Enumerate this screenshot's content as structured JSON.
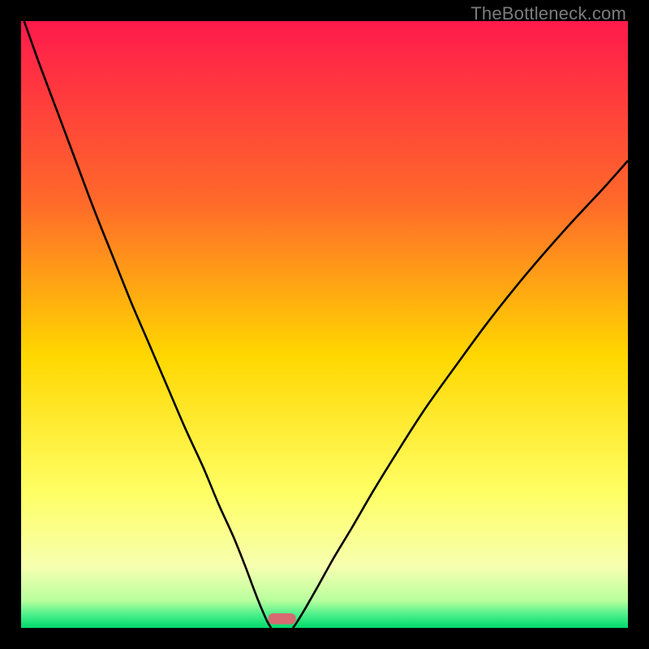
{
  "watermark": "TheBottleneck.com",
  "chart_data": {
    "type": "line",
    "title": "",
    "xlabel": "",
    "ylabel": "",
    "xlim": [
      0,
      1
    ],
    "ylim": [
      0,
      1
    ],
    "gradient_stops": [
      {
        "y": 0.0,
        "color": "#ff1a4b"
      },
      {
        "y": 0.3,
        "color": "#ff6a2a"
      },
      {
        "y": 0.55,
        "color": "#ffd700"
      },
      {
        "y": 0.78,
        "color": "#ffff66"
      },
      {
        "y": 0.9,
        "color": "#f6ffb0"
      },
      {
        "y": 0.955,
        "color": "#b8ff9e"
      },
      {
        "y": 0.978,
        "color": "#4cf08a"
      },
      {
        "y": 1.0,
        "color": "#00d96b"
      }
    ],
    "left_curve": {
      "note": "v-shaped curve left branch, (x, y) with y=1 at top, y≈0 near x≈0.40",
      "points": [
        [
          0.005,
          1.0
        ],
        [
          0.03,
          0.93
        ],
        [
          0.06,
          0.85
        ],
        [
          0.09,
          0.77
        ],
        [
          0.12,
          0.69
        ],
        [
          0.15,
          0.615
        ],
        [
          0.18,
          0.54
        ],
        [
          0.21,
          0.47
        ],
        [
          0.24,
          0.4
        ],
        [
          0.27,
          0.33
        ],
        [
          0.3,
          0.265
        ],
        [
          0.325,
          0.205
        ],
        [
          0.35,
          0.15
        ],
        [
          0.37,
          0.1
        ],
        [
          0.385,
          0.06
        ],
        [
          0.397,
          0.03
        ],
        [
          0.406,
          0.01
        ],
        [
          0.412,
          0.0
        ]
      ]
    },
    "right_curve": {
      "note": "v-shaped curve right branch, (x, y)",
      "points": [
        [
          0.448,
          0.0
        ],
        [
          0.455,
          0.01
        ],
        [
          0.47,
          0.035
        ],
        [
          0.49,
          0.07
        ],
        [
          0.515,
          0.115
        ],
        [
          0.545,
          0.165
        ],
        [
          0.58,
          0.225
        ],
        [
          0.62,
          0.29
        ],
        [
          0.665,
          0.36
        ],
        [
          0.715,
          0.43
        ],
        [
          0.77,
          0.505
        ],
        [
          0.83,
          0.58
        ],
        [
          0.895,
          0.655
        ],
        [
          0.96,
          0.725
        ],
        [
          1.0,
          0.77
        ]
      ]
    },
    "marker": {
      "note": "small rounded pink marker at valley floor",
      "x_center": 0.43,
      "y_center": 0.985,
      "width": 0.045,
      "height": 0.018,
      "color": "#d86a72"
    }
  }
}
